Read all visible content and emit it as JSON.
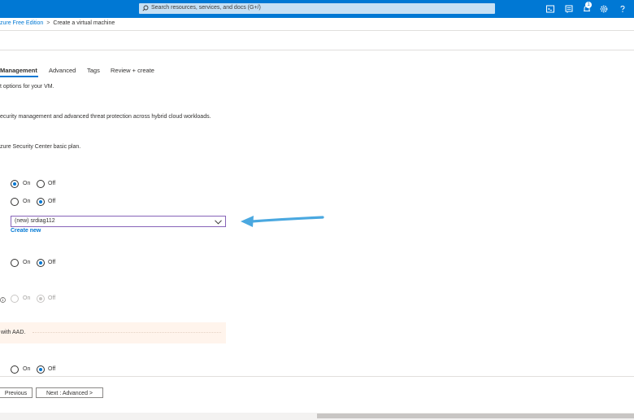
{
  "topbar": {
    "search_placeholder": "Search resources, services, and docs (G+/)",
    "notification_count": "1",
    "icons": [
      "cloud-shell-icon",
      "directory-filter-icon",
      "notifications-icon",
      "settings-icon",
      "help-icon"
    ],
    "brand_color": "#0078d4"
  },
  "breadcrumb": {
    "parent": "zure Free Edition",
    "current": "Create a virtual machine"
  },
  "tabs": [
    {
      "label": "Management",
      "active": true
    },
    {
      "label": "Advanced"
    },
    {
      "label": "Tags"
    },
    {
      "label": "Review + create"
    }
  ],
  "texts": {
    "intro": "t options for your VM.",
    "security_desc": "ecurity management and advanced threat protection across hybrid cloud workloads.",
    "security_plan": "zure Security Center basic plan.",
    "aad_note": "with AAD."
  },
  "radio_groups": [
    {
      "on_label": "On",
      "off_label": "Off",
      "selected": "on"
    },
    {
      "on_label": "On",
      "off_label": "Off",
      "selected": "off"
    },
    {
      "on_label": "On",
      "off_label": "Off",
      "selected": "off"
    },
    {
      "on_label": "On",
      "off_label": "Off",
      "selected": "off",
      "disabled": true
    },
    {
      "on_label": "On",
      "off_label": "Off",
      "selected": "off"
    }
  ],
  "storage_account": {
    "value": "(new) srdiag112",
    "create_new": "Create new"
  },
  "footer": {
    "previous_label": "Previous",
    "next_label": "Next : Advanced >"
  },
  "annotation_arrow_color": "#4aa8e0"
}
